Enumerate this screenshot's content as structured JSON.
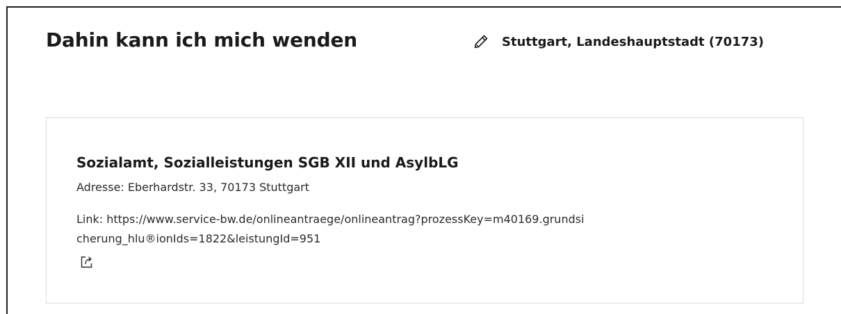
{
  "section": {
    "title": "Dahin kann ich mich wenden",
    "location": "Stuttgart, Landeshauptstadt (70173)",
    "location_icon": "pencil-icon"
  },
  "contact_card": {
    "title": "Sozialamt, Sozialleistungen SGB XII und AsylbLG",
    "address": "Adresse: Eberhardstr. 33, 70173 Stuttgart",
    "link_line1": "Link: https://www.service-bw.de/onlineantraege/onlineantrag?prozessKey=m40169.grundsi",
    "link_line2": "cherung_hlu®ionIds=1822&leistungId=951",
    "link_icon": "external-link-icon"
  },
  "colors": {
    "text": "#1a1a1a",
    "card_border": "#dcdcdc",
    "frame_border": "#1f1f1f"
  }
}
